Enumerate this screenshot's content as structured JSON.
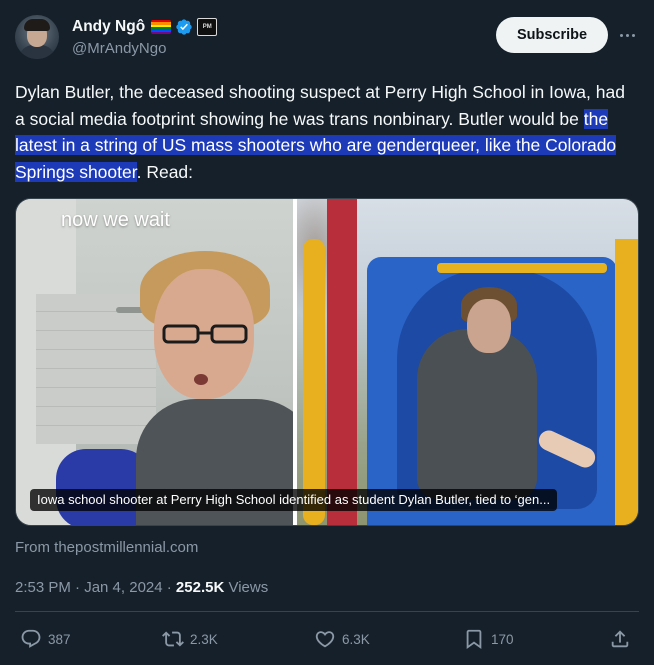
{
  "author": {
    "name": "Andy Ngô",
    "handle": "@MrAndyNgo",
    "affiliate_badge": "PM"
  },
  "subscribe_label": "Subscribe",
  "tweet": {
    "text_before": "Dylan Butler, the deceased shooting suspect at Perry High School in Iowa, had a social media footprint showing he was trans nonbinary. Butler would be ",
    "text_highlight": "the latest in a string of US mass shooters who are genderqueer, like the Colorado Springs shooter",
    "text_after": ". Read:"
  },
  "media": {
    "left_overlay_text": "now we wait",
    "card_caption": "Iowa school shooter at Perry High School identified as student Dylan Butler, tied to ‘gen..."
  },
  "source_text": "From thepostmillennial.com",
  "meta": {
    "time_date": "2:53 PM · Jan 4, 2024 · ",
    "views_count": "252.5K",
    "views_label": " Views"
  },
  "actions": {
    "replies": "387",
    "reposts": "2.3K",
    "likes": "6.3K",
    "bookmarks": "170"
  },
  "colors": {
    "background": "#15202b",
    "highlight": "#1d3bb8",
    "muted_text": "#8b98a5",
    "verified": "#1d9bf0"
  }
}
